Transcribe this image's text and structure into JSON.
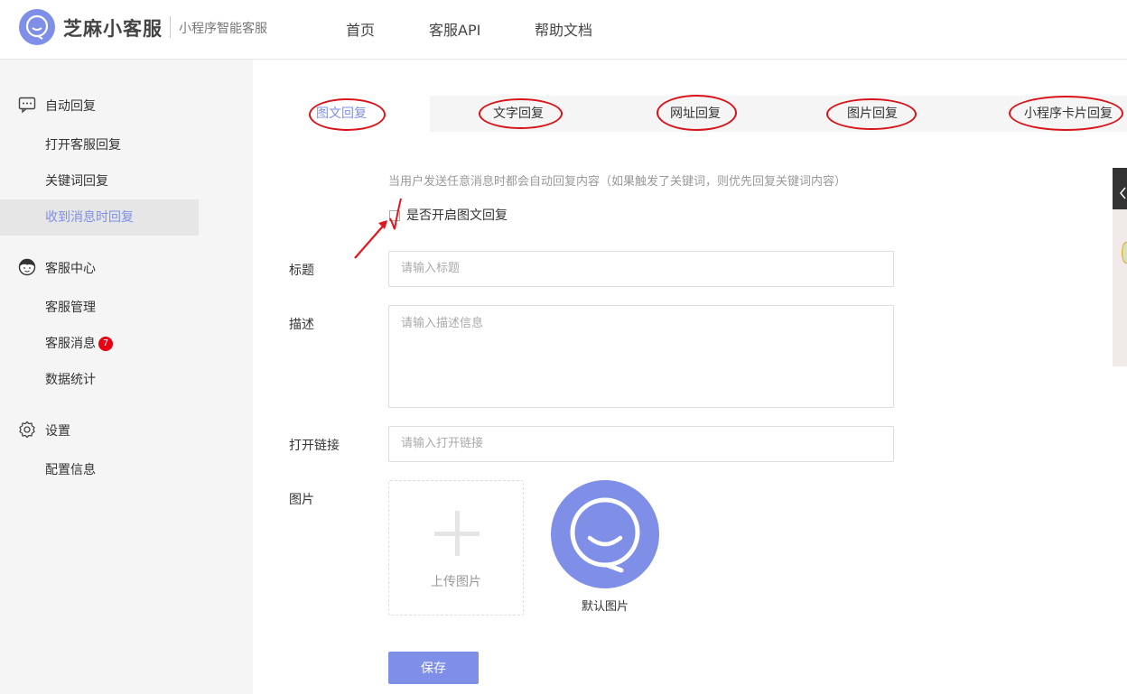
{
  "app": {
    "brand_name": "芝麻小客服",
    "brand_subtitle": "小程序智能客服",
    "accent_color": "#7f8fe8",
    "annotation_color": "#d8141a"
  },
  "topnav": [
    "首页",
    "客服API",
    "帮助文档"
  ],
  "sidebar": {
    "groups": [
      {
        "title": "自动回复",
        "icon": "chat-icon",
        "items": [
          {
            "label": "打开客服回复"
          },
          {
            "label": "关键词回复"
          },
          {
            "label": "收到消息时回复",
            "active": true
          }
        ]
      },
      {
        "title": "客服中心",
        "icon": "agent-avatar-icon",
        "items": [
          {
            "label": "客服管理"
          },
          {
            "label": "客服消息",
            "badge": "7"
          },
          {
            "label": "数据统计"
          }
        ]
      },
      {
        "title": "设置",
        "icon": "gear-icon",
        "items": [
          {
            "label": "配置信息"
          }
        ]
      }
    ]
  },
  "tabs": [
    {
      "label": "图文回复",
      "active": true
    },
    {
      "label": "文字回复"
    },
    {
      "label": "网址回复"
    },
    {
      "label": "图片回复"
    },
    {
      "label": "小程序卡片回复"
    }
  ],
  "form": {
    "hint": "当用户发送任意消息时都会自动回复内容（如果触发了关键词，则优先回复关键词内容）",
    "enable_label": "是否开启图文回复",
    "enable_checked": false,
    "title_label": "标题",
    "title_placeholder": "请输入标题",
    "desc_label": "描述",
    "desc_placeholder": "请输入描述信息",
    "link_label": "打开链接",
    "link_placeholder": "请输入打开链接",
    "image_label": "图片",
    "upload_label": "上传图片",
    "default_image_label": "默认图片",
    "save_label": "保存"
  }
}
